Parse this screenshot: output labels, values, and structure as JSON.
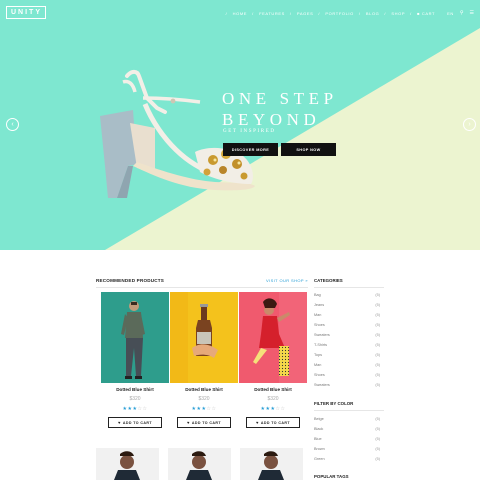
{
  "brand": {
    "logo": "UNITY"
  },
  "nav": {
    "items": [
      "HOME",
      "FEATURES",
      "PAGES",
      "PORTFOLIO",
      "BLOG",
      "SHOP"
    ],
    "cart_label": "CART",
    "currency": "EN"
  },
  "hero": {
    "heading_line1": "ONE STEP",
    "heading_line2": "BEYOND",
    "subheading": "GET INSPIRED",
    "btn_discover": "DISCOVER MORE",
    "btn_shop": "SHOP NOW",
    "colors": {
      "teal": "#7ee7d0",
      "cream": "#ecf4d0"
    }
  },
  "products": {
    "title": "RECOMMENDED PRODUCTS",
    "visit_link": "VISIT OUR SHOP »",
    "items": [
      {
        "name": "Dotted Blue Shirt",
        "price": "$320",
        "rating": 3,
        "cart": "ADD TO CART"
      },
      {
        "name": "Dotted Blue Shirt",
        "price": "$320",
        "rating": 3,
        "cart": "ADD TO CART"
      },
      {
        "name": "Dotted Blue Shirt",
        "price": "$320",
        "rating": 3,
        "cart": "ADD TO CART"
      }
    ]
  },
  "sidebar": {
    "categories_title": "CATEGORIES",
    "categories": [
      {
        "label": "Bag",
        "count": "(5)"
      },
      {
        "label": "Jeans",
        "count": "(5)"
      },
      {
        "label": "Man",
        "count": "(5)"
      },
      {
        "label": "Shoes",
        "count": "(5)"
      },
      {
        "label": "Sweaters",
        "count": "(5)"
      },
      {
        "label": "T-Shirts",
        "count": "(5)"
      },
      {
        "label": "Tops",
        "count": "(5)"
      },
      {
        "label": "Man",
        "count": "(5)"
      },
      {
        "label": "Shoes",
        "count": "(5)"
      },
      {
        "label": "Sweaters",
        "count": "(5)"
      }
    ],
    "filter_title": "FILTER BY COLOR",
    "colors": [
      {
        "label": "Beige",
        "count": "(5)"
      },
      {
        "label": "Black",
        "count": "(5)"
      },
      {
        "label": "Blue",
        "count": "(5)"
      },
      {
        "label": "Brown",
        "count": "(5)"
      },
      {
        "label": "Green",
        "count": "(5)"
      }
    ],
    "tags_title": "POPULAR TAGS"
  }
}
